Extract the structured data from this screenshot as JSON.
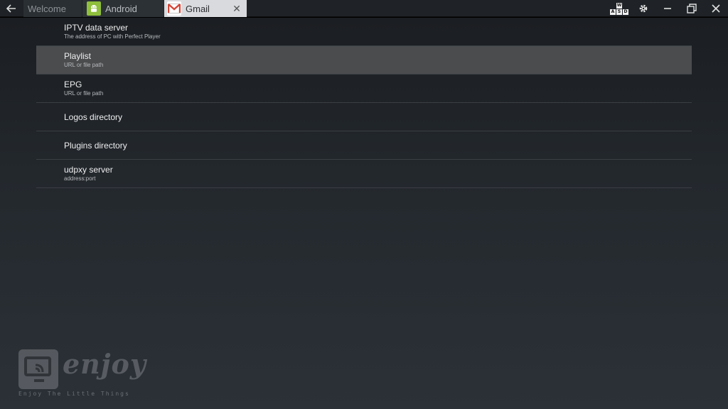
{
  "tabs": [
    {
      "label": "Welcome"
    },
    {
      "label": "Android"
    },
    {
      "label": "Gmail"
    }
  ],
  "window_controls": {
    "keymap_keys": [
      "W",
      "A",
      "S",
      "D"
    ]
  },
  "settings": [
    {
      "title": "IPTV data server",
      "subtitle": "The address of PC with Perfect Player"
    },
    {
      "title": "Playlist",
      "subtitle": "URL or file path"
    },
    {
      "title": "EPG",
      "subtitle": "URL or file path"
    },
    {
      "title": "Logos directory"
    },
    {
      "title": "Plugins directory"
    },
    {
      "title": "udpxy server",
      "subtitle": "address:port"
    }
  ],
  "watermark": {
    "script": "enjoy",
    "tagline": "Enjoy The Little Things"
  },
  "colors": {
    "selected_row": "#4a4c4e",
    "android_green": "#8fbf3c",
    "gmail_red": "#d44638"
  }
}
